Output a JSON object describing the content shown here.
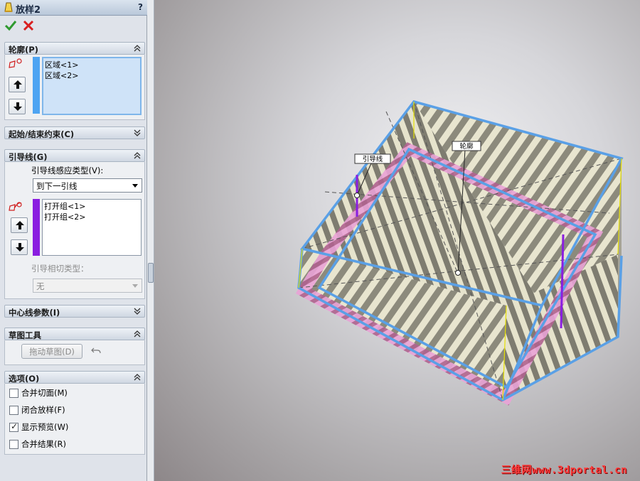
{
  "window": {
    "title": "放样2",
    "help": "?"
  },
  "actions": {
    "ok": "confirm-check",
    "cancel": "cancel-x"
  },
  "profiles": {
    "header": "轮廓(P)",
    "items": [
      "区域<1>",
      "区域<2>"
    ]
  },
  "start_end": {
    "header": "起始/结束约束(C)"
  },
  "guides": {
    "header": "引导线(G)",
    "influence_label": "引导线感应类型(V):",
    "influence_value": "到下一引线",
    "items": [
      "打开组<1>",
      "打开组<2>"
    ],
    "tangency_label": "引导相切类型：",
    "tangency_value": "无"
  },
  "centerline": {
    "header": "中心线参数(I)"
  },
  "sketch_tools": {
    "header": "草图工具",
    "drag_button": "拖动草图(D)"
  },
  "options": {
    "header": "选项(O)",
    "items": [
      {
        "label": "合并切面(M)",
        "checked": false
      },
      {
        "label": "闭合放样(F)",
        "checked": false
      },
      {
        "label": "显示预览(W)",
        "checked": true
      },
      {
        "label": "合并结果(R)",
        "checked": false
      }
    ]
  },
  "viewport": {
    "callouts": {
      "guide": "引导线",
      "profile": "轮廓"
    },
    "watermark": "三维网www.3dportal.cn"
  },
  "colors": {
    "profile_blue": "#5aa0e6",
    "guide_purple": "#8a1ee0",
    "pink": "#e08ad0",
    "accent": "#3a6ea5"
  }
}
